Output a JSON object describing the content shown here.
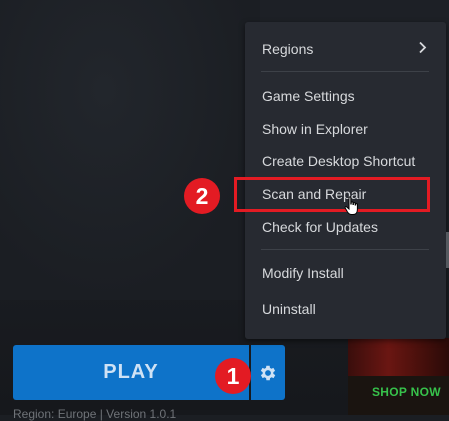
{
  "menu": {
    "regions": "Regions",
    "game_settings": "Game Settings",
    "show_in_explorer": "Show in Explorer",
    "create_shortcut": "Create Desktop Shortcut",
    "scan_and_repair": "Scan and Repair",
    "check_updates": "Check for Updates",
    "modify_install": "Modify Install",
    "uninstall": "Uninstall"
  },
  "play": {
    "label": "PLAY"
  },
  "version_line": "Region: Europe  |  Version 1.0.1",
  "promo": {
    "shop_now": "SHOP NOW"
  },
  "annotations": {
    "step1": "1",
    "step2": "2"
  },
  "colors": {
    "play_blue": "#0e73c9",
    "highlight_red": "#e31b23",
    "shop_green": "#37c24b",
    "menu_bg": "#272a31"
  },
  "icons": {
    "regions_chevron": "chevron-right-icon",
    "settings": "gear-icon",
    "cursor": "hand-pointer-icon"
  }
}
